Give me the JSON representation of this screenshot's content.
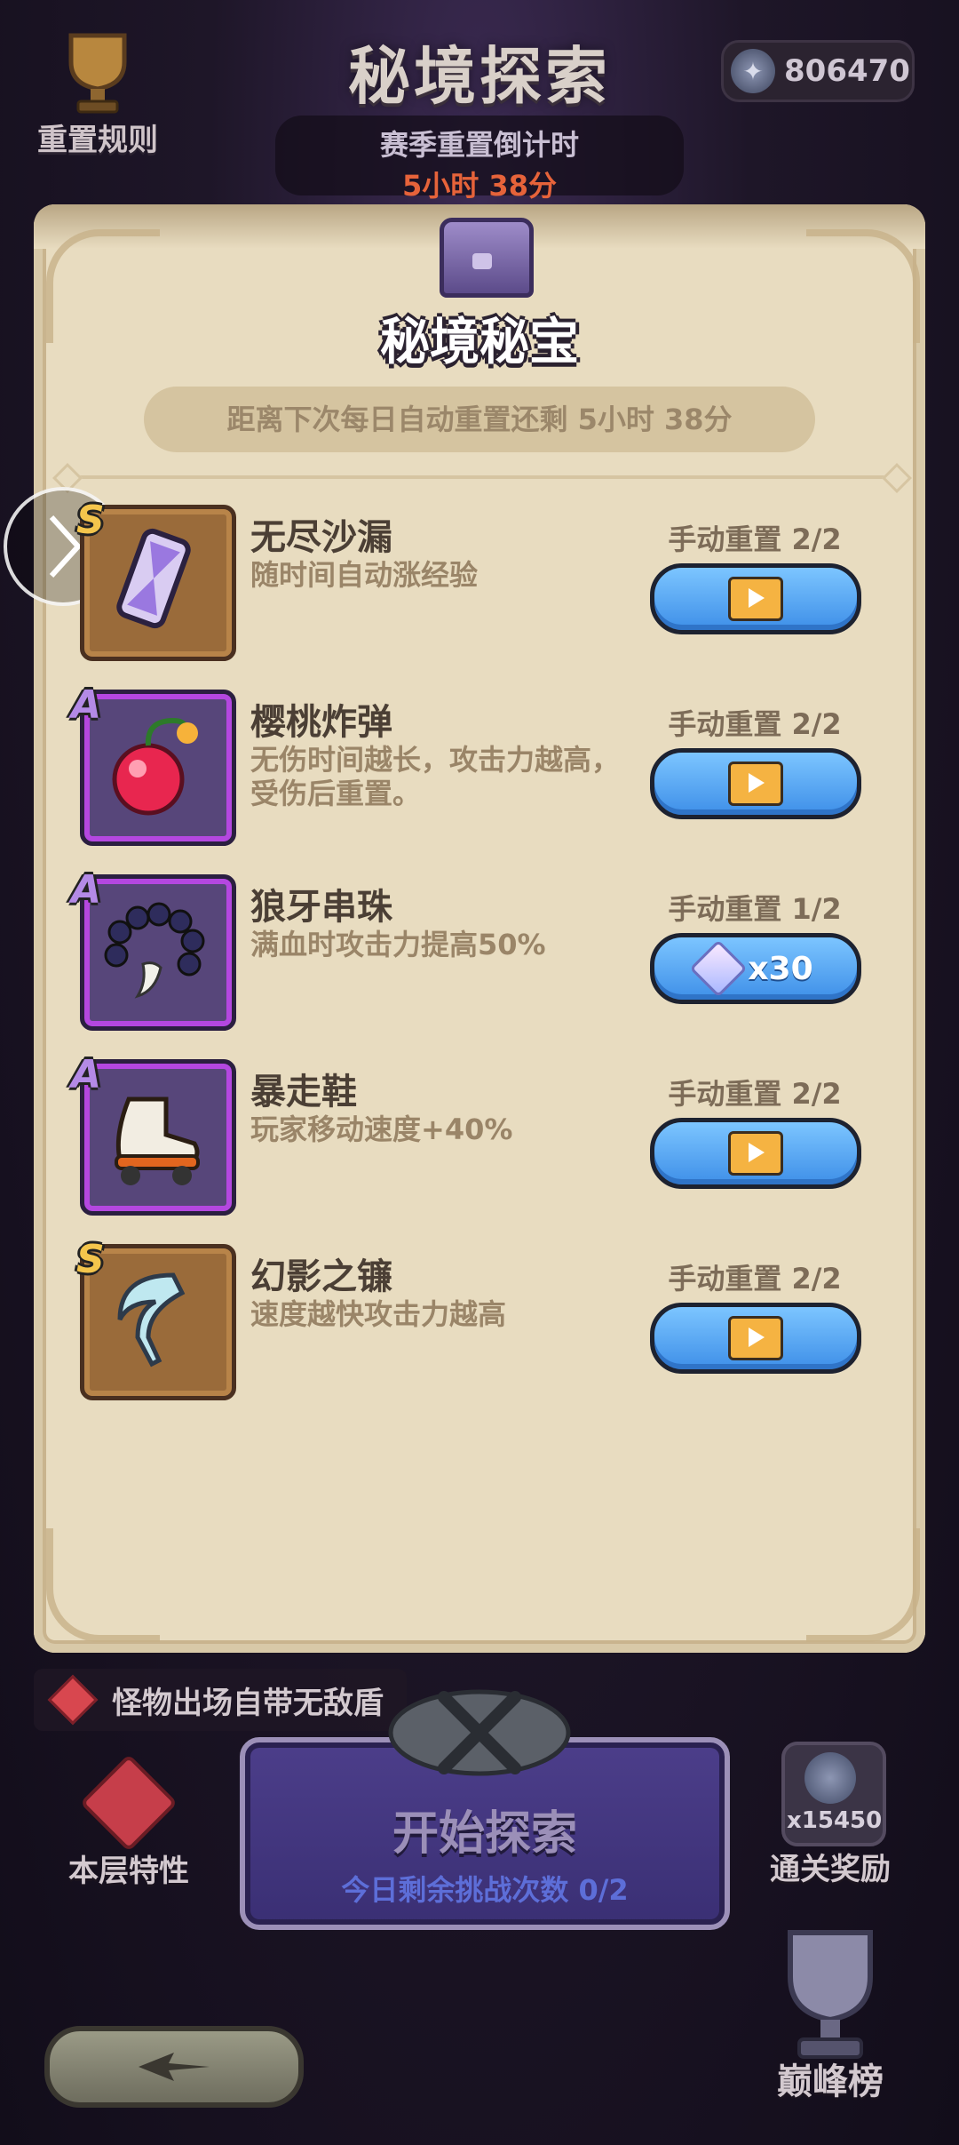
{
  "header": {
    "title": "秘境探索",
    "countdown_label": "赛季重置倒计时",
    "countdown_value": "5小时 38分",
    "rules_label": "重置规则",
    "currency_icon": "star-coin-icon",
    "currency_value": "806470"
  },
  "panel": {
    "title": "秘境秘宝",
    "reset_banner": "距离下次每日自动重置还剩 5小时 38分",
    "items": [
      {
        "rank": "S",
        "name": "无尽沙漏",
        "desc": "随时间自动涨经验",
        "reset": "手动重置 2/2",
        "button": "video",
        "icon": "hourglass-icon"
      },
      {
        "rank": "A",
        "name": "樱桃炸弹",
        "desc": "无伤时间越长，攻击力越高，受伤后重置。",
        "reset": "手动重置 2/2",
        "button": "video",
        "icon": "cherry-bomb-icon"
      },
      {
        "rank": "A",
        "name": "狼牙串珠",
        "desc": "满血时攻击力提高50%",
        "reset": "手动重置 1/2",
        "button": "gem",
        "button_label": "x30",
        "icon": "fang-beads-icon"
      },
      {
        "rank": "A",
        "name": "暴走鞋",
        "desc": "玩家移动速度+40%",
        "reset": "手动重置 2/2",
        "button": "video",
        "icon": "roller-skate-icon"
      },
      {
        "rank": "S",
        "name": "幻影之镰",
        "desc": "速度越快攻击力越高",
        "reset": "手动重置 2/2",
        "button": "video",
        "icon": "phantom-sickle-icon"
      }
    ]
  },
  "bottom": {
    "floor_tip": "怪物出场自带无敌盾",
    "floor_label": "本层特性",
    "start_title": "开始探索",
    "start_sub": "今日剩余挑战次数 0/2",
    "reward_count": "x15450",
    "reward_label": "通关奖励",
    "leaderboard_label": "巅峰榜"
  },
  "colors": {
    "panel_bg": "#e8dcc0",
    "button_blue": "#4a9cf0",
    "countdown_orange": "#e6633a",
    "rank_s": "#f4c54c",
    "rank_a": "#b447e0"
  }
}
